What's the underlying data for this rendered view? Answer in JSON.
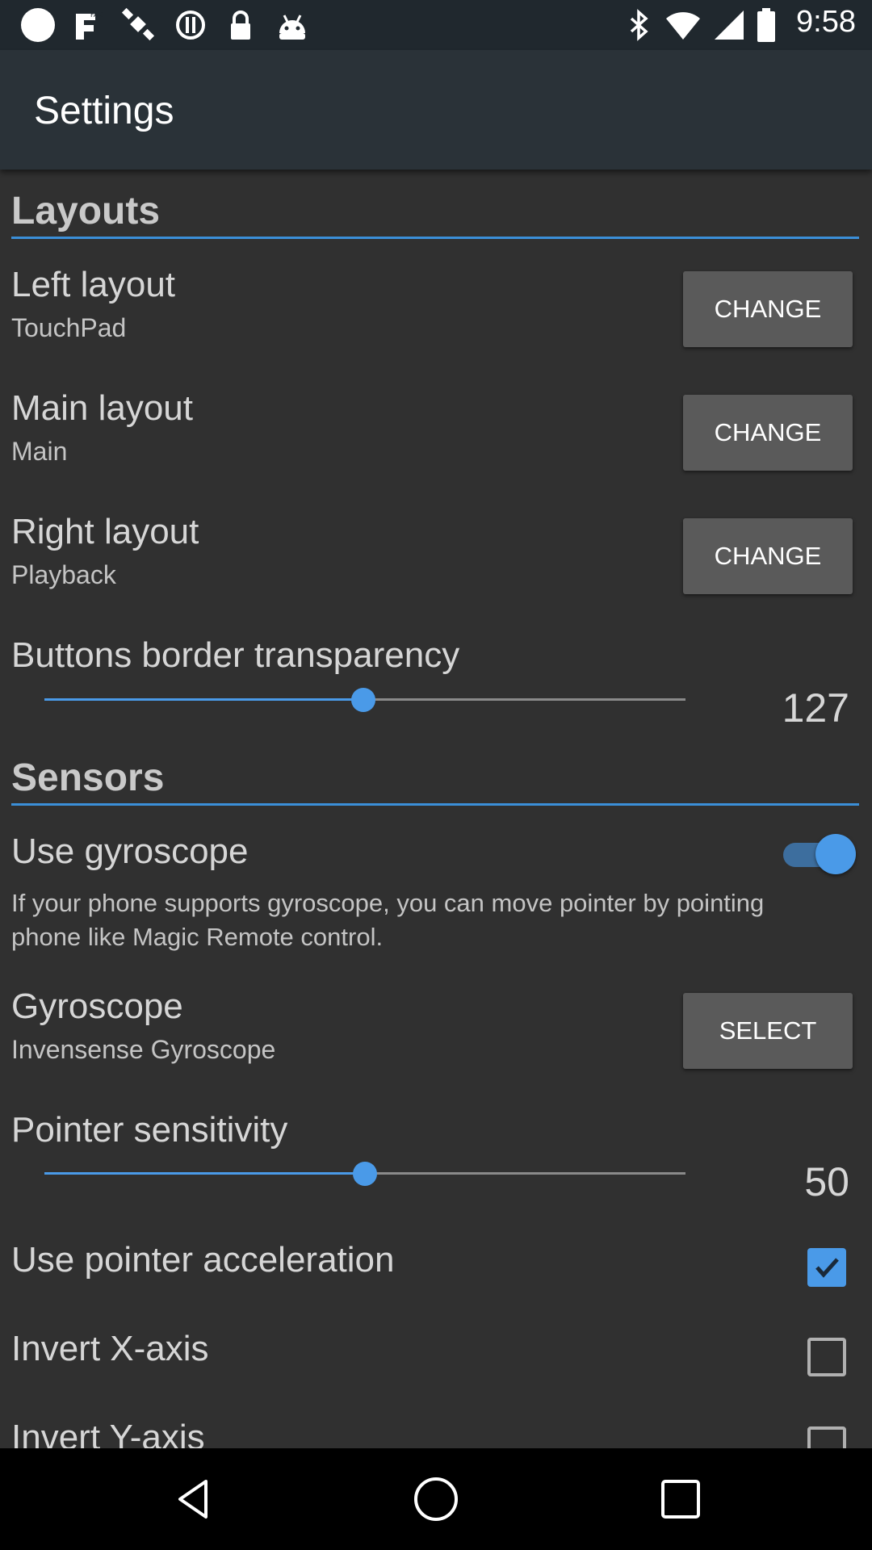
{
  "status_bar": {
    "time": "9:58",
    "left_icons": [
      "circle-notification-icon",
      "fake-gps-icon",
      "satellite-icon",
      "vibrate-icon",
      "lock-icon",
      "android-icon"
    ],
    "right_icons": [
      "bluetooth-icon",
      "wifi-icon",
      "signal-icon",
      "battery-icon"
    ]
  },
  "app_bar": {
    "title": "Settings"
  },
  "sections": {
    "layouts": {
      "header": "Layouts",
      "left_layout": {
        "title": "Left layout",
        "value": "TouchPad",
        "button": "CHANGE"
      },
      "main_layout": {
        "title": "Main layout",
        "value": "Main",
        "button": "CHANGE"
      },
      "right_layout": {
        "title": "Right layout",
        "value": "Playback",
        "button": "CHANGE"
      },
      "border_transparency": {
        "title": "Buttons border transparency",
        "value": "127",
        "min": 0,
        "max": 255
      }
    },
    "sensors": {
      "header": "Sensors",
      "use_gyroscope": {
        "title": "Use gyroscope",
        "description": "If your phone supports gyroscope, you can move pointer by pointing phone like Magic Remote control.",
        "enabled": true
      },
      "gyroscope": {
        "title": "Gyroscope",
        "value": "Invensense Gyroscope",
        "button": "SELECT"
      },
      "pointer_sensitivity": {
        "title": "Pointer sensitivity",
        "value": "50",
        "min": 0,
        "max": 100
      },
      "pointer_acceleration": {
        "title": "Use pointer acceleration",
        "checked": true
      },
      "invert_x": {
        "title": "Invert X-axis",
        "checked": false
      },
      "invert_y": {
        "title": "Invert Y-axis",
        "checked": false
      }
    }
  },
  "nav_bar": {
    "buttons": [
      "back-icon",
      "home-icon",
      "recents-icon"
    ]
  },
  "colors": {
    "accent": "#4a9ae8",
    "background": "#303030",
    "app_bar": "#2a3238",
    "button": "#5a5a5a"
  }
}
